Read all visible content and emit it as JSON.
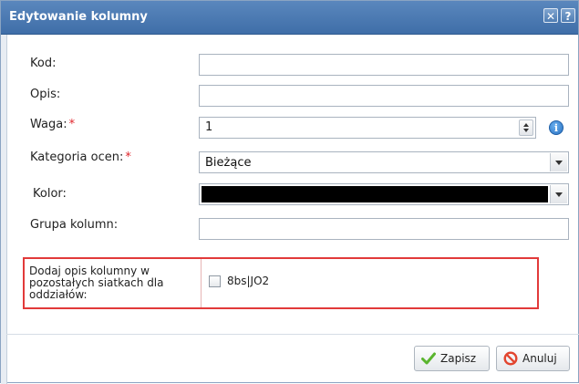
{
  "dialog": {
    "title": "Edytowanie kolumny",
    "close_icon": "close-icon",
    "help_icon": "help-icon",
    "close_glyph": "✕",
    "help_glyph": "?"
  },
  "form": {
    "kod": {
      "label": "Kod:",
      "value": ""
    },
    "opis": {
      "label": "Opis:",
      "value": ""
    },
    "waga": {
      "label": "Waga:",
      "required_mark": "*",
      "value": "1",
      "info_glyph": "i"
    },
    "kategoria": {
      "label": "Kategoria ocen:",
      "required_mark": "*",
      "selected": "Bieżące"
    },
    "kolor": {
      "label": "Kolor:",
      "selected_color": "#000000"
    },
    "grupa": {
      "label": "Grupa kolumn:",
      "value": ""
    }
  },
  "extra": {
    "description": "Dodaj opis kolumny w pozostałych siatkach dla oddziałów:",
    "checkbox_label": "8bs|JO2",
    "checked": false
  },
  "footer": {
    "save_label": "Zapisz",
    "cancel_label": "Anuluj"
  },
  "colors": {
    "title_bar": "#4a78b1",
    "highlight_border": "#e23a3a",
    "required": "#e0252b"
  }
}
